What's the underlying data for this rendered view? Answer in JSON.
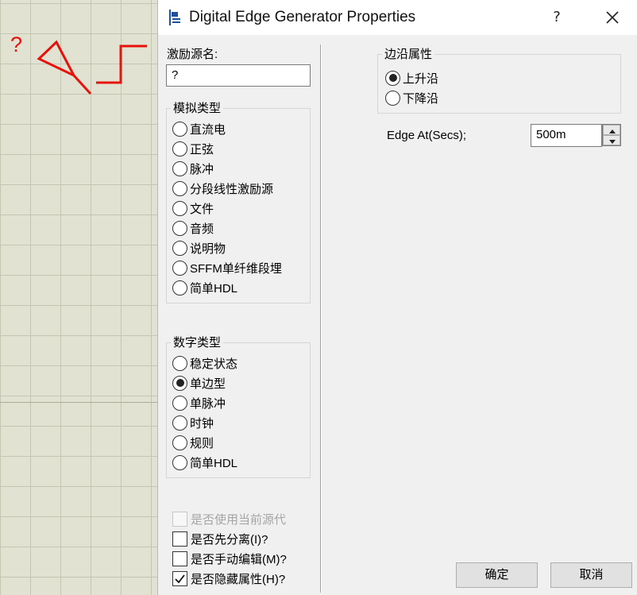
{
  "canvas": {
    "probe_label": "?"
  },
  "dialog": {
    "title": "Digital Edge Generator Properties",
    "help_label": "?",
    "generator_name": {
      "label": "激励源名:",
      "value": "?"
    },
    "analog_types": {
      "title": "模拟类型",
      "options": [
        {
          "label": "直流电",
          "selected": false
        },
        {
          "label": "正弦",
          "selected": false
        },
        {
          "label": "脉冲",
          "selected": false
        },
        {
          "label": "分段线性激励源",
          "selected": false
        },
        {
          "label": "文件",
          "selected": false
        },
        {
          "label": "音频",
          "selected": false
        },
        {
          "label": "说明物",
          "selected": false
        },
        {
          "label": "SFFM单纤维段埋",
          "selected": false
        },
        {
          "label": "简单HDL",
          "selected": false
        }
      ]
    },
    "digital_types": {
      "title": "数字类型",
      "options": [
        {
          "label": "稳定状态",
          "selected": false
        },
        {
          "label": "单边型",
          "selected": true
        },
        {
          "label": "单脉冲",
          "selected": false
        },
        {
          "label": "时钟",
          "selected": false
        },
        {
          "label": "规则",
          "selected": false
        },
        {
          "label": "简单HDL",
          "selected": false
        }
      ]
    },
    "checkboxes": [
      {
        "label": "是否使用当前源代",
        "checked": false,
        "disabled": true
      },
      {
        "label": "是否先分离(I)?",
        "checked": false,
        "disabled": false
      },
      {
        "label": "是否手动编辑(M)?",
        "checked": false,
        "disabled": false
      },
      {
        "label": "是否隐藏属性(H)?",
        "checked": true,
        "disabled": false
      }
    ],
    "edge_properties": {
      "title": "边沿属性",
      "options": [
        {
          "label": "上升沿",
          "selected": true
        },
        {
          "label": "下降沿",
          "selected": false
        }
      ]
    },
    "edge_at": {
      "label": "Edge At(Secs);",
      "value": "500m"
    },
    "ok_label": "确定",
    "cancel_label": "取消"
  },
  "colors": {
    "wire_red": "#e8120c",
    "grid_bg": "#e2e2d2",
    "dialog_bg": "#f0f0f0"
  }
}
